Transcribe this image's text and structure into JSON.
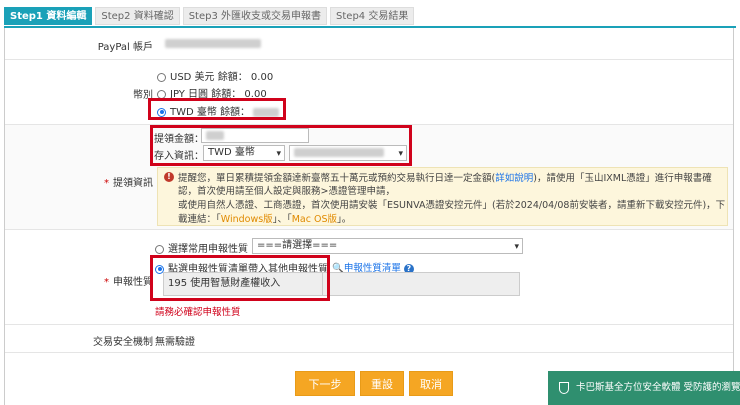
{
  "steps": [
    {
      "num": "Step1",
      "label": "資料編輯"
    },
    {
      "num": "Step2",
      "label": "資料確認"
    },
    {
      "num": "Step3",
      "label": "外匯收支或交易申報書"
    },
    {
      "num": "Step4",
      "label": "交易結果"
    }
  ],
  "paypal": {
    "label": "PayPal 帳戶"
  },
  "currency": {
    "label": "幣別",
    "options": [
      {
        "text": "USD 美元",
        "balance_label": "餘額：",
        "balance": "0.00"
      },
      {
        "text": "JPY 日圓",
        "balance_label": "餘額：",
        "balance": "0.00"
      },
      {
        "text": "TWD 臺幣",
        "balance_label": "餘額："
      }
    ]
  },
  "withdraw": {
    "label": "提領資訊",
    "amount_label": "提領金額：",
    "deposit_label": "存入資訊：",
    "deposit_currency": "TWD 臺幣",
    "notice": {
      "line1_a": "提醒您，單日累積提領金額達新臺幣五十萬元或預約交易執行日達一定金額(",
      "line1_link": "詳如說明",
      "line1_b": ")，請使用「玉山IXML憑證」進行申報書確",
      "line2": "認，首次使用請至個人設定與服務>憑證管理申請，",
      "line3": "或使用自然人憑證、工商憑證，首次使用請安裝「ESUNVA憑證安控元件」(若於2024/04/08前安裝者，請重新下載安控元件)，下",
      "line4_a": "載連結：「",
      "line4_win": "Windows版",
      "line4_mid": "」、「",
      "line4_mac": "Mac OS版",
      "line4_end": "」。"
    }
  },
  "nature": {
    "label": "申報性質",
    "option1": "選擇常用申報性質",
    "select_value": "===請選擇===",
    "option2": "點選申報性質清單帶入其他申報性質",
    "list_link": "申報性質清單",
    "help_icon": "?",
    "value": "195 使用智慧財產權收入",
    "error": "請務必確認申報性質"
  },
  "security": {
    "label": "交易安全機制",
    "value": "無需驗證"
  },
  "buttons": {
    "next": "下一步",
    "reset": "重設",
    "cancel": "取消"
  },
  "toast": {
    "text": "卡巴斯基全方位安全軟體 受防護的瀏覽器"
  },
  "colors": {
    "accent": "#1aa1b8",
    "button": "#f5a623",
    "highlight": "#d0021b",
    "toast": "#2f8f6f"
  }
}
